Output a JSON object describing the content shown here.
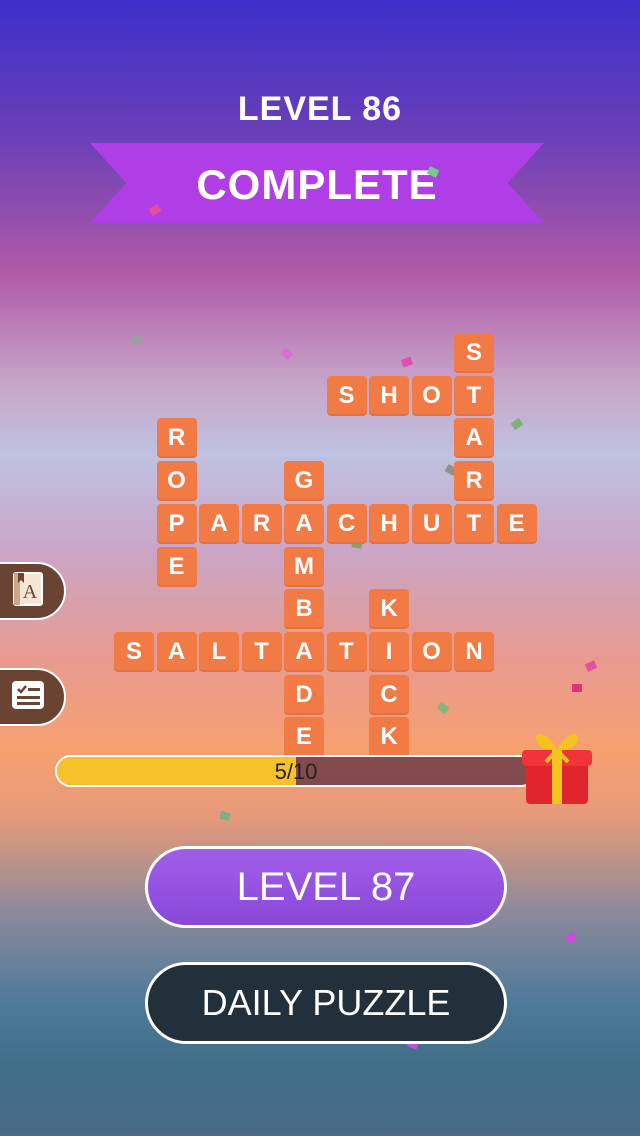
{
  "header": {
    "level_label": "LEVEL 86",
    "status": "COMPLETE"
  },
  "tiles": [
    {
      "ch": "S",
      "col": 8,
      "row": 0
    },
    {
      "ch": "T",
      "col": 8,
      "row": 1
    },
    {
      "ch": "A",
      "col": 8,
      "row": 2
    },
    {
      "ch": "R",
      "col": 8,
      "row": 3
    },
    {
      "ch": "S",
      "col": 5,
      "row": 1
    },
    {
      "ch": "H",
      "col": 6,
      "row": 1
    },
    {
      "ch": "O",
      "col": 7,
      "row": 1
    },
    {
      "ch": "R",
      "col": 1,
      "row": 2
    },
    {
      "ch": "O",
      "col": 1,
      "row": 3
    },
    {
      "ch": "P",
      "col": 1,
      "row": 4
    },
    {
      "ch": "E",
      "col": 1,
      "row": 5
    },
    {
      "ch": "G",
      "col": 4,
      "row": 3
    },
    {
      "ch": "A",
      "col": 4,
      "row": 4
    },
    {
      "ch": "M",
      "col": 4,
      "row": 5
    },
    {
      "ch": "B",
      "col": 4,
      "row": 6
    },
    {
      "ch": "A",
      "col": 4,
      "row": 7
    },
    {
      "ch": "D",
      "col": 4,
      "row": 8
    },
    {
      "ch": "E",
      "col": 4,
      "row": 9
    },
    {
      "ch": "A",
      "col": 2,
      "row": 4
    },
    {
      "ch": "R",
      "col": 3,
      "row": 4
    },
    {
      "ch": "C",
      "col": 5,
      "row": 4
    },
    {
      "ch": "H",
      "col": 6,
      "row": 4
    },
    {
      "ch": "U",
      "col": 7,
      "row": 4
    },
    {
      "ch": "T",
      "col": 8,
      "row": 4
    },
    {
      "ch": "E",
      "col": 9,
      "row": 4
    },
    {
      "ch": "K",
      "col": 6,
      "row": 6
    },
    {
      "ch": "I",
      "col": 6,
      "row": 7
    },
    {
      "ch": "C",
      "col": 6,
      "row": 8
    },
    {
      "ch": "K",
      "col": 6,
      "row": 9
    },
    {
      "ch": "S",
      "col": 0,
      "row": 7
    },
    {
      "ch": "A",
      "col": 1,
      "row": 7
    },
    {
      "ch": "L",
      "col": 2,
      "row": 7
    },
    {
      "ch": "T",
      "col": 3,
      "row": 7
    },
    {
      "ch": "T",
      "col": 5,
      "row": 7
    },
    {
      "ch": "O",
      "col": 7,
      "row": 7
    },
    {
      "ch": "N",
      "col": 8,
      "row": 7
    }
  ],
  "side_buttons": [
    {
      "name": "dictionary-icon"
    },
    {
      "name": "checklist-icon"
    }
  ],
  "progress": {
    "text": "5/10",
    "fraction": 0.5
  },
  "buttons": {
    "next_label": "LEVEL 87",
    "daily_label": "DAILY PUZZLE"
  }
}
